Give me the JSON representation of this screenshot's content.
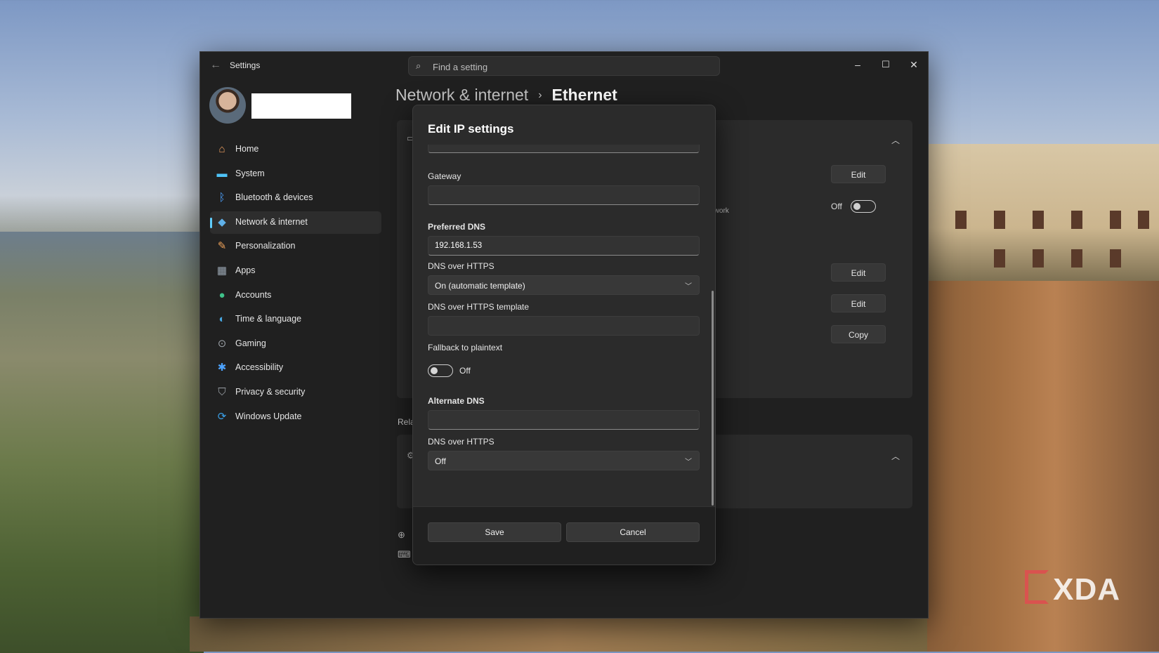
{
  "window": {
    "app_title": "Settings",
    "search_placeholder": "Find a setting",
    "controls": {
      "minimize": "–",
      "maximize": "☐",
      "close": "✕"
    }
  },
  "breadcrumb": {
    "parent": "Network & internet",
    "separator": "›",
    "current": "Ethernet"
  },
  "sidebar": {
    "items": [
      {
        "label": "Home",
        "icon": "home-icon",
        "glyph": "⌂",
        "color": "#f0a060"
      },
      {
        "label": "System",
        "icon": "system-icon",
        "glyph": "▬",
        "color": "#4fc3f7"
      },
      {
        "label": "Bluetooth & devices",
        "icon": "bluetooth-icon",
        "glyph": "ᛒ",
        "color": "#4da3ff"
      },
      {
        "label": "Network & internet",
        "icon": "network-icon",
        "glyph": "◆",
        "color": "#5fb0e8"
      },
      {
        "label": "Personalization",
        "icon": "brush-icon",
        "glyph": "✎",
        "color": "#f0a35a"
      },
      {
        "label": "Apps",
        "icon": "apps-icon",
        "glyph": "▦",
        "color": "#9aa6b2"
      },
      {
        "label": "Accounts",
        "icon": "accounts-icon",
        "glyph": "●",
        "color": "#3fc28a"
      },
      {
        "label": "Time & language",
        "icon": "globe-icon",
        "glyph": "◐",
        "color": "#47a6e0"
      },
      {
        "label": "Gaming",
        "icon": "gamepad-icon",
        "glyph": "⊙",
        "color": "#9aa0a6"
      },
      {
        "label": "Accessibility",
        "icon": "accessibility-icon",
        "glyph": "✱",
        "color": "#4da3ff"
      },
      {
        "label": "Privacy & security",
        "icon": "shield-icon",
        "glyph": "⛉",
        "color": "#9aa0a6"
      },
      {
        "label": "Windows Update",
        "icon": "update-icon",
        "glyph": "⟳",
        "color": "#3aa0e8"
      }
    ],
    "active_index": 3
  },
  "main": {
    "buttons": {
      "edit1": "Edit",
      "edit2": "Edit",
      "edit3": "Edit",
      "copy": "Copy"
    },
    "metered_suffix": "s network",
    "metered_state": "Off",
    "related_label": "Rela"
  },
  "dialog": {
    "title": "Edit IP settings",
    "gateway_label": "Gateway",
    "gateway_value": "",
    "preferred_dns_label": "Preferred DNS",
    "preferred_dns_value": "192.168.1.53",
    "doh_label": "DNS over HTTPS",
    "doh_value": "On (automatic template)",
    "doh_template_label": "DNS over HTTPS template",
    "doh_template_value": "",
    "fallback_label": "Fallback to plaintext",
    "fallback_state": "Off",
    "alternate_dns_label": "Alternate DNS",
    "alternate_dns_value": "",
    "alt_doh_label": "DNS over HTTPS",
    "alt_doh_value": "Off",
    "save": "Save",
    "cancel": "Cancel"
  },
  "watermark": "XDA"
}
